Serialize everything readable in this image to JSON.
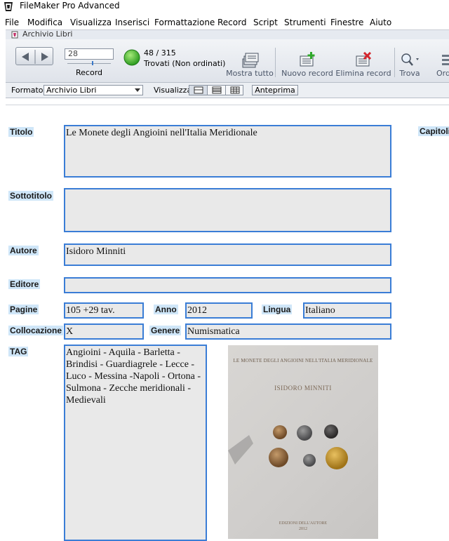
{
  "app": {
    "title": "FileMaker Pro Advanced"
  },
  "menu": [
    "File",
    "Modifica",
    "Visualizza",
    "Inserisci",
    "Formattazione",
    "Record",
    "Script",
    "Strumenti",
    "Finestre",
    "Aiuto"
  ],
  "window": {
    "title": "Archivio Libri"
  },
  "toolbar": {
    "record_value": "28",
    "record_label": "Record",
    "found_count": "48 / 315",
    "found_status": "Trovati (Non ordinati)",
    "buttons": {
      "show_all": "Mostra tutto",
      "new_record": "Nuovo record",
      "delete_record": "Elimina record",
      "find": "Trova",
      "sort": "Ord"
    }
  },
  "layoutbar": {
    "format_label": "Formato:",
    "format_value": "Archivio Libri",
    "view_label": "Visualizza:",
    "preview": "Anteprima"
  },
  "record": {
    "labels": {
      "titolo": "Titolo",
      "sottotitolo": "Sottotitolo",
      "autore": "Autore",
      "editore": "Editore",
      "pagine": "Pagine",
      "anno": "Anno",
      "lingua": "Lingua",
      "collocazione": "Collocazione",
      "genere": "Genere",
      "tag": "TAG",
      "capitoli": "Capitoli"
    },
    "values": {
      "titolo": "Le Monete degli Angioini nell'Italia Meridionale",
      "sottotitolo": "",
      "autore": "Isidoro Minniti",
      "editore": "",
      "pagine": "105  +29 tav.",
      "anno": "2012",
      "lingua": "Italiano",
      "collocazione": "X",
      "genere": "Numismatica",
      "tag": "Angioini - Aquila - Barletta - Brindisi - Guardiagrele - Lecce - Luco - Messina -Napoli - Ortona - Sulmona - Zecche meridionali - Medievali"
    },
    "cover": {
      "title": "LE MONETE DEGLI ANGIOINI NELL'ITALIA MERIDIONALE",
      "author": "ISIDORO MINNITI",
      "publisher": "EDIZIONI DELL'AUTORE",
      "year": "2012"
    }
  },
  "colors": {
    "field_border": "#3a7dd6",
    "field_bg": "#e9e9e9",
    "label_bg": "#cfe6f8",
    "toolbar_bg": "#dfe3ea"
  }
}
